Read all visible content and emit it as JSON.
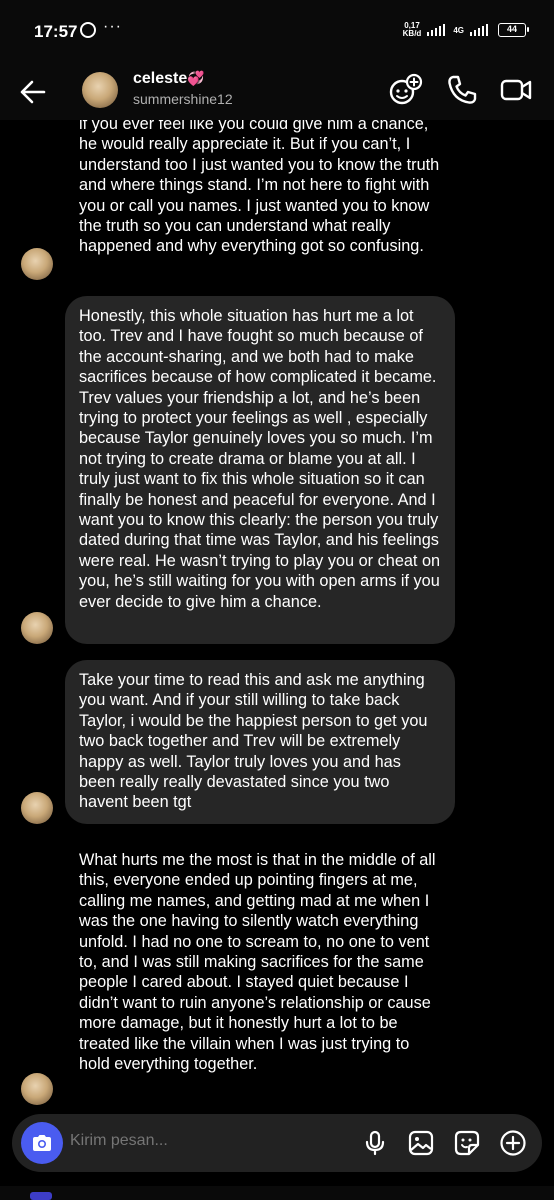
{
  "status": {
    "time": "17:57",
    "dots": "···",
    "net_speed_top": "0,17",
    "net_speed_bottom": "KB/d",
    "network": "4G",
    "battery": "44"
  },
  "header": {
    "contact_name": "celeste",
    "contact_emoji": "💞",
    "username": "summershine12"
  },
  "messages": [
    "if you ever feel like you could give him a chance, he would really appreciate it. But if you can’t, I understand too I just wanted you to know the truth and where things stand. I’m not here to fight with you or call you names. I just wanted you to know the truth so you can understand what really happened and why everything got so confusing.",
    "Honestly, this whole situation has hurt me a lot too. Trev and I have fought so much because of the account-sharing, and we both had to make sacrifices because of how complicated it became. Trev values your friendship a lot, and he’s been trying to protect your feelings as well , especially because Taylor genuinely loves you so much. I’m not trying to create drama or blame you at all. I truly just want to fix this whole situation so it can finally be honest and peaceful for everyone. And I want you to know this clearly: the person you truly dated during that time was Taylor, and his feelings were real. He wasn’t trying to play you or cheat on you, he’s still waiting for you with open arms if you ever decide to give him a chance.",
    "Take your time to read this and ask me anything you want. And if your still willing to take back Taylor, i would be the happiest person to get you two back together and Trev will be extremely happy as well. Taylor truly loves you and has been really really devastated since you two havent been tgt",
    "What hurts me the most is that in the middle of all this, everyone ended up pointing fingers at me, calling me names, and getting mad at me when I was the one having to silently watch everything unfold. I had no one to scream to, no one to vent to, and I was still making sacrifices for the same people I cared about. I stayed quiet because I didn’t want to ruin anyone’s relationship or cause more damage, but it honestly hurt a lot to be treated like the villain when I was just trying to hold everything together."
  ],
  "composer": {
    "placeholder": "Kirim pesan..."
  },
  "colors": {
    "background": "#000000",
    "bubble": "#262626",
    "accent": "#4a5cf0"
  }
}
